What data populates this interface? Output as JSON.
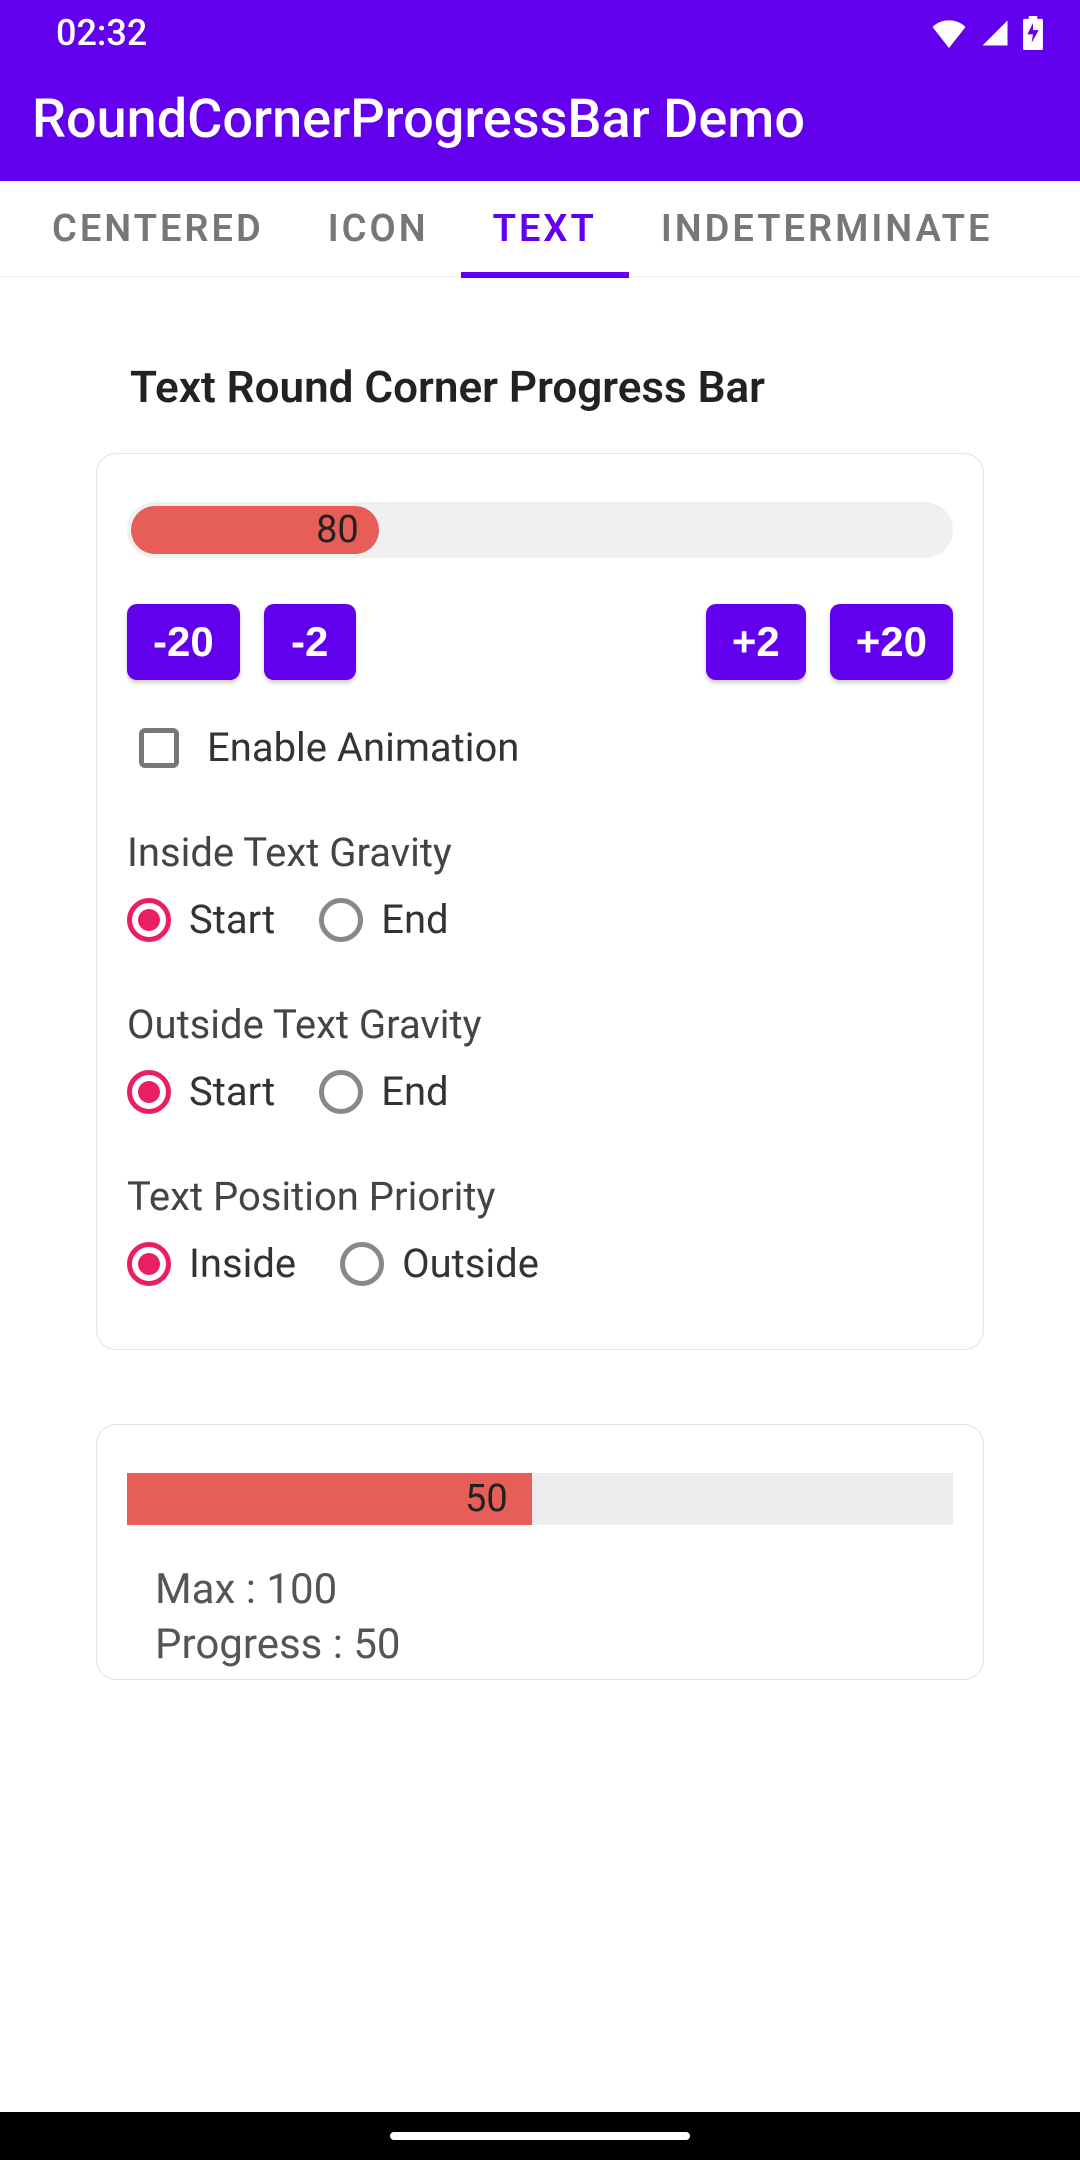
{
  "status": {
    "time": "02:32"
  },
  "app": {
    "title": "RoundCornerProgressBar Demo"
  },
  "tabs": {
    "centered": "Centered",
    "icon": "Icon",
    "text": "Text",
    "indeterminate": "Indeterminate",
    "active": "text"
  },
  "section": {
    "title": "Text Round Corner Progress Bar"
  },
  "card1": {
    "progress": {
      "value": 80,
      "max": 100,
      "text": "80",
      "fill_percent": 30
    },
    "buttons": {
      "dec20": "-20",
      "dec2": "-2",
      "inc2": "+2",
      "inc20": "+20"
    },
    "enable_anim": {
      "label": "Enable Animation",
      "checked": false
    },
    "inside_gravity": {
      "label": "Inside Text Gravity",
      "start": "Start",
      "end": "End",
      "selected": "start"
    },
    "outside_gravity": {
      "label": "Outside Text Gravity",
      "start": "Start",
      "end": "End",
      "selected": "start"
    },
    "priority": {
      "label": "Text Position Priority",
      "inside": "Inside",
      "outside": "Outside",
      "selected": "inside"
    }
  },
  "card2": {
    "progress": {
      "value": 50,
      "max": 100,
      "text": "50",
      "fill_percent": 50
    },
    "max_line": "Max : 100",
    "progress_line": "Progress : 50"
  },
  "colors": {
    "primary": "#6200EE",
    "accent": "#E91E63",
    "progress_fill": "#E75E58"
  }
}
